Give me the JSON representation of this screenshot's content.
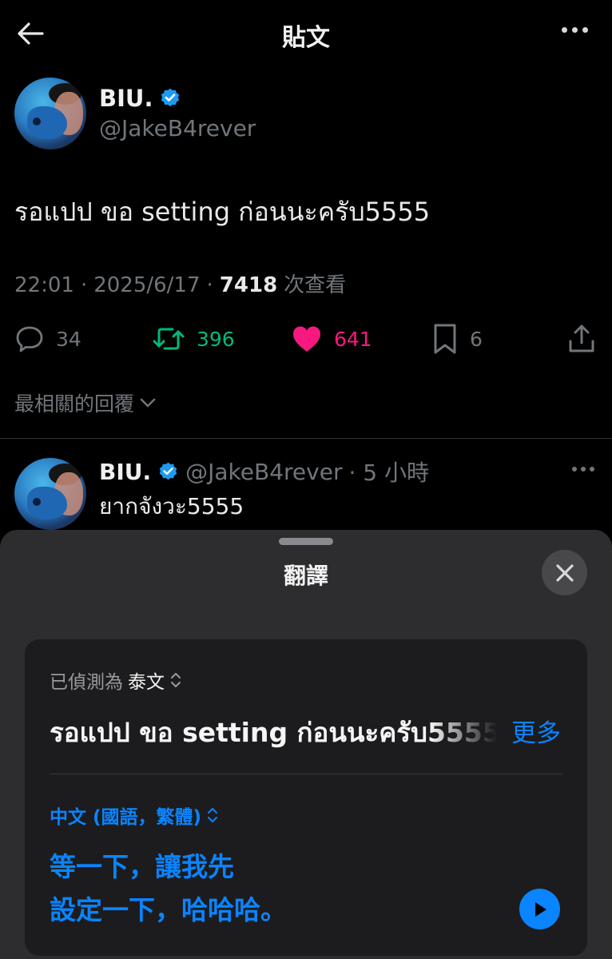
{
  "header": {
    "title": "貼文"
  },
  "post": {
    "display_name": "BIU.",
    "handle": "@JakeB4rever",
    "text": "รอแปป ขอ setting ก่อนนะครับ5555",
    "time": "22:01",
    "dot": "·",
    "date": "2025/6/17",
    "views": "7418",
    "views_label": "次查看",
    "replies": "34",
    "retweets": "396",
    "likes": "641",
    "bookmarks": "6"
  },
  "replies_sort": {
    "label": "最相關的回覆"
  },
  "reply": {
    "display_name": "BIU.",
    "handle": "@JakeB4rever",
    "age": "· 5 小時",
    "text": "ยากจังวะ5555"
  },
  "translation_sheet": {
    "title": "翻譯",
    "detected_prefix": "已偵測為",
    "source_language": "泰文",
    "source_text": "รอแปป ขอ setting ก่อนนะครับ5555",
    "more_label": "更多",
    "target_language": "中文 (國語，繁體)",
    "translated_lines": [
      "等一下，讓我先",
      "設定一下，哈哈哈。"
    ]
  },
  "icons": {
    "back": "arrow-left-icon",
    "more": "ellipsis-icon",
    "verified": "verified-badge-icon",
    "reply": "speech-bubble-icon",
    "retweet": "retweet-icon",
    "like": "heart-icon",
    "bookmark": "bookmark-icon",
    "share": "share-icon",
    "chevron": "chevron-down-icon",
    "close": "close-icon",
    "play": "play-icon",
    "updown": "chevron-up-down-icon"
  },
  "colors": {
    "background": "#000000",
    "sheet": "#2d2d2f",
    "card": "#1c1c1e",
    "accent_blue": "#0a84ff",
    "verified_blue": "#1d9bf0",
    "retweet_green": "#00ba7c",
    "like_pink": "#f91880",
    "muted_text": "#71767b"
  }
}
